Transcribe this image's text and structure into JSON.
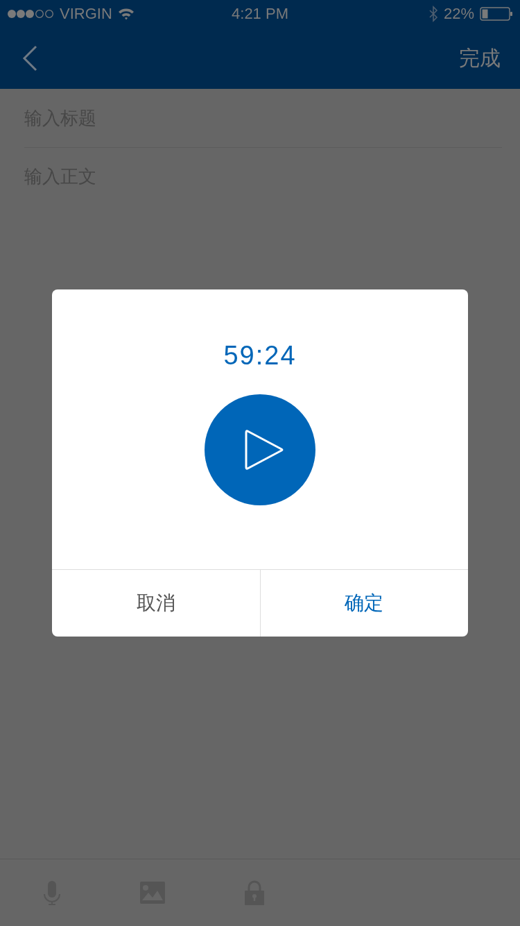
{
  "status_bar": {
    "carrier": "VIRGIN",
    "time": "4:21 PM",
    "battery": "22%"
  },
  "nav_bar": {
    "action": "完成"
  },
  "editor": {
    "title_placeholder": "输入标题",
    "body_placeholder": "输入正文"
  },
  "dialog": {
    "timer": "59:24",
    "buttons": [
      {
        "label": "取消",
        "kind": "cancel"
      },
      {
        "label": "确定",
        "kind": "confirm"
      }
    ]
  }
}
